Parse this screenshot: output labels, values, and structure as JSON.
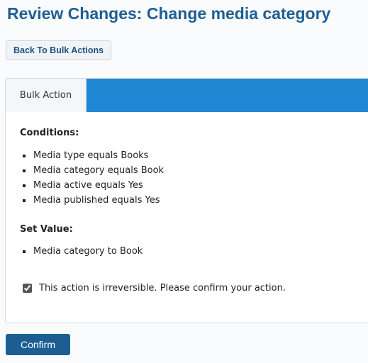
{
  "page": {
    "title": "Review Changes: Change media category"
  },
  "toolbar": {
    "back_label": "Back To Bulk Actions"
  },
  "tabs": [
    {
      "label": "Bulk Action",
      "active": true
    }
  ],
  "conditions": {
    "heading": "Conditions:",
    "items": [
      "Media type equals Books",
      "Media category equals Book",
      "Media active equals Yes",
      "Media published equals Yes"
    ]
  },
  "set_value": {
    "heading": "Set Value:",
    "items": [
      "Media category to Book"
    ]
  },
  "confirmation": {
    "checked": true,
    "text": "This action is irreversible. Please confirm your action."
  },
  "actions": {
    "confirm_label": "Confirm"
  },
  "colors": {
    "title": "#1e5f95",
    "tab_strip": "#1e88d4",
    "confirm_button": "#1c5e92"
  }
}
